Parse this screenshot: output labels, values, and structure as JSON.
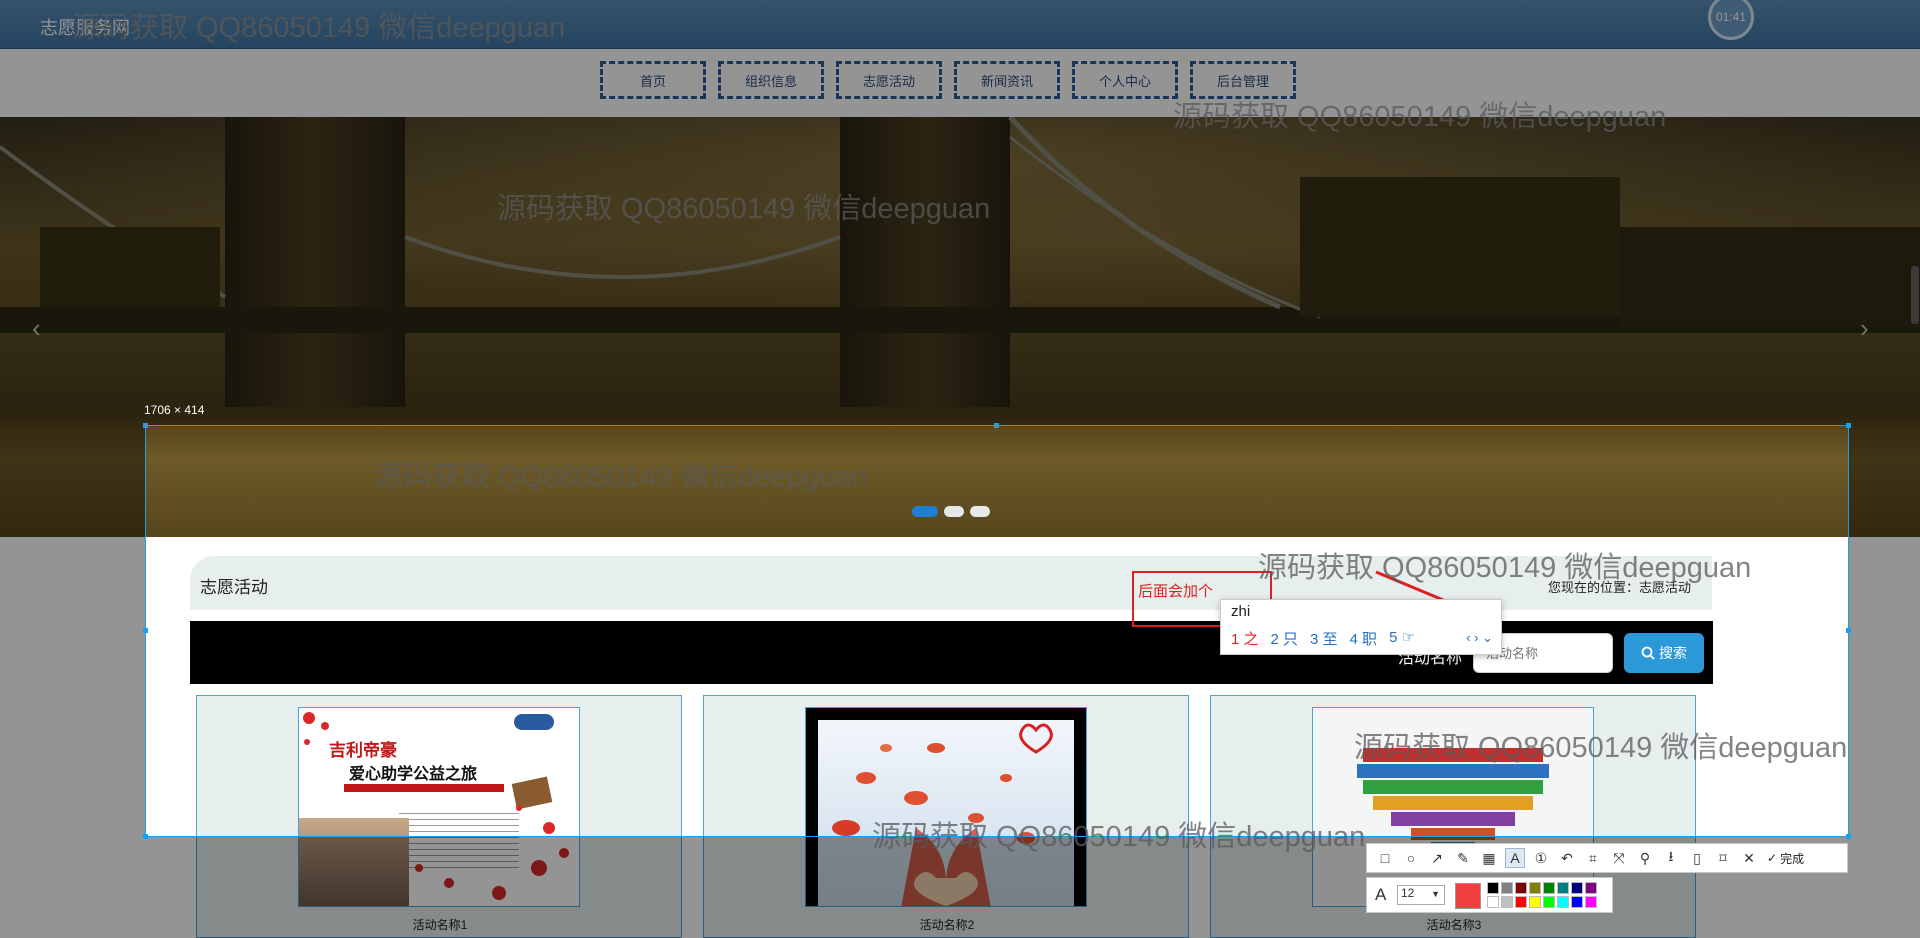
{
  "header": {
    "site_title": "志愿服务网",
    "clock": "01:41"
  },
  "nav": {
    "items": [
      "首页",
      "组织信息",
      "志愿活动",
      "新闻资讯",
      "个人中心",
      "后台管理"
    ]
  },
  "banner": {
    "prev_arrow": "‹",
    "next_arrow": "›",
    "slide_count": 3,
    "active_slide": 1
  },
  "capture": {
    "size_label": "1706 × 414"
  },
  "section": {
    "title": "志愿活动",
    "location": "您现在的位置：志愿活动"
  },
  "search": {
    "label": "活动名称",
    "placeholder": "活动名称",
    "button": "搜索"
  },
  "cards": [
    {
      "name": "活动名称1",
      "poster_title": "吉利帝豪",
      "poster_subtitle": "爱心助学公益之旅"
    },
    {
      "name": "活动名称2"
    },
    {
      "name": "活动名称3"
    }
  ],
  "annotation": {
    "text": "后面会加个"
  },
  "ime": {
    "input": "zhi",
    "candidates": [
      "1 之",
      "2 只",
      "3 至",
      "4 职",
      "5 ☞"
    ],
    "nav": "‹ › ⌄"
  },
  "toolbar": {
    "done_label": "完成",
    "font_size": "12"
  },
  "palette": [
    "#000000",
    "#808080",
    "#800000",
    "#808000",
    "#008000",
    "#008080",
    "#000080",
    "#800080",
    "#ffffff",
    "#c0c0c0",
    "#ff0000",
    "#ffff00",
    "#00ff00",
    "#00ffff",
    "#0000ff",
    "#ff00ff"
  ],
  "watermark": "源码获取 QQ86050149 微信deepguan"
}
